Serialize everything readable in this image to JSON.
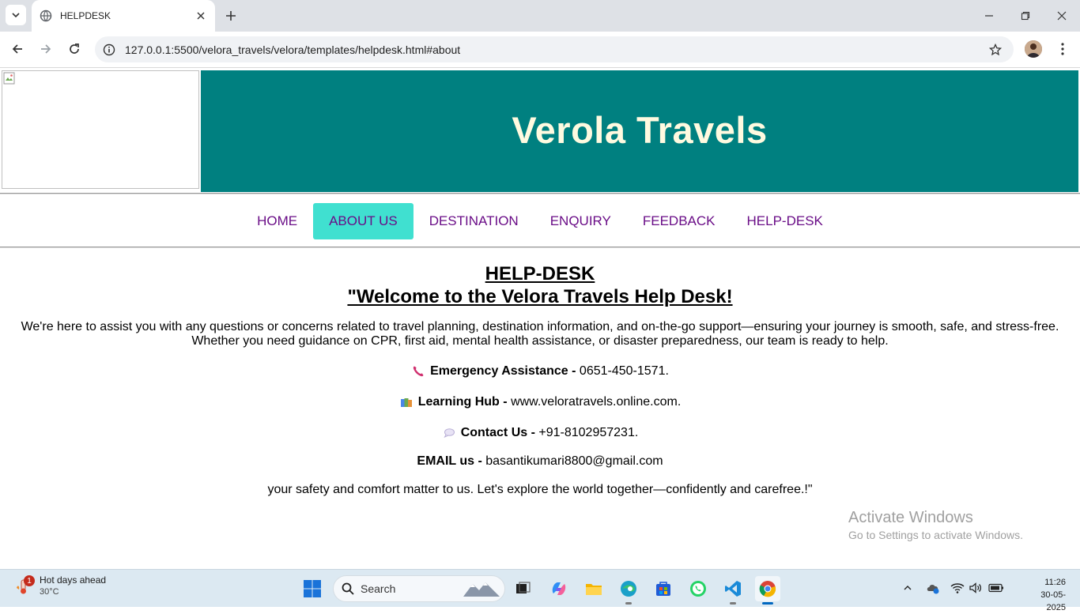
{
  "browser": {
    "tab_title": "HELPDESK",
    "url": "127.0.0.1:5500/velora_travels/velora/templates/helpdesk.html#about"
  },
  "site": {
    "banner_title": "Verola Travels",
    "nav": [
      {
        "label": "HOME"
      },
      {
        "label": "ABOUT US",
        "active": true
      },
      {
        "label": "DESTINATION"
      },
      {
        "label": "ENQUIRY"
      },
      {
        "label": "FEEDBACK"
      },
      {
        "label": "HELP-DESK"
      }
    ],
    "colors": {
      "banner": "#008080",
      "banner_text": "#fffae0",
      "nav_text": "#6a0d87",
      "nav_active": "#40e0d0"
    }
  },
  "helpdesk": {
    "heading": "HELP-DESK",
    "welcome": "\"Welcome to the Velora Travels Help Desk!",
    "intro_line1": "We're here to assist you with any questions or concerns related to travel planning, destination information, and on-the-go support—ensuring your journey is smooth, safe, and stress-free.",
    "intro_line2": "Whether you need guidance on CPR, first aid, mental health assistance, or disaster preparedness, our team is ready to help.",
    "emergency": {
      "icon": "phone-icon",
      "label": "Emergency Assistance -",
      "value": "0651-450-1571."
    },
    "learning": {
      "icon": "books-icon",
      "label": "Learning Hub -",
      "value": "www.veloratravels.online.com."
    },
    "contact": {
      "icon": "speech-bubble-icon",
      "label": "Contact Us -",
      "value": "+91-8102957231."
    },
    "email": {
      "label": "EMAIL us -",
      "value": "basantikumari8800@gmail.com"
    },
    "closing": "your safety and comfort matter to us. Let's explore the world together—confidently and carefree.!\""
  },
  "watermark": {
    "line1": "Activate Windows",
    "line2": "Go to Settings to activate Windows."
  },
  "taskbar": {
    "weather_title": "Hot days ahead",
    "weather_temp": "30°C",
    "weather_badge": "1",
    "search_label": "Search",
    "time": "11:26",
    "date": "30-05-2025"
  }
}
